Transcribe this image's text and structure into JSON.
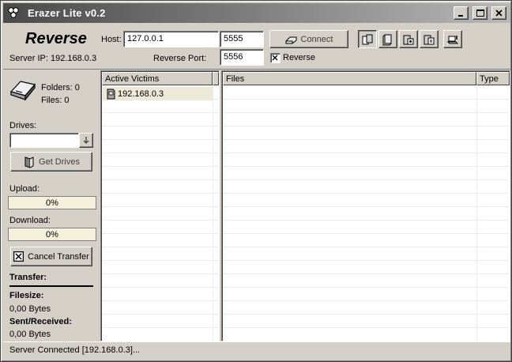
{
  "window": {
    "title": "Erazer Lite v0.2",
    "app_icon": "erazer-app-icon",
    "controls": [
      "minimize-icon",
      "maximize-icon",
      "close-icon"
    ]
  },
  "connection": {
    "mode_title": "Reverse",
    "server_ip_label": "Server IP: 192.168.0.3",
    "host_label": "Host:",
    "host_value": "127.0.0.1",
    "port_value": "5555",
    "reverse_port_label": "Reverse Port:",
    "reverse_port_value": "5556",
    "connect_label": "Connect",
    "reverse_checkbox_label": "Reverse",
    "reverse_checked": true
  },
  "toolbar": {
    "icons": [
      "file-manager-icon",
      "drive-icon",
      "explorer-icon",
      "process-icon",
      "settings-icon"
    ],
    "active_index": 0
  },
  "sidebar": {
    "folders_label": "Folders: 0",
    "files_label": "Files: 0",
    "drives_label": "Drives:",
    "drives_selected": "",
    "get_drives_label": "Get Drives",
    "upload_label": "Upload:",
    "upload_percent": "0%",
    "upload_fraction": 0,
    "download_label": "Download:",
    "download_percent": "0%",
    "download_fraction": 0,
    "cancel_transfer_label": "Cancel Transfer",
    "transfer_heading": "Transfer:",
    "filesize_label": "Filesize:",
    "filesize_value": "0,00 Bytes",
    "sent_received_label": "Sent/Received:",
    "sent_received_value": "0,00 Bytes"
  },
  "victims": {
    "header": "Active Victims",
    "items": [
      {
        "label": "192.168.0.3",
        "icon": "computer-icon"
      }
    ]
  },
  "files": {
    "columns": [
      "Files",
      "Type"
    ],
    "rows": []
  },
  "status": {
    "text": "Server Connected [192.168.0.3]..."
  },
  "colors": {
    "face": "#d4d0c8",
    "title_start": "#4a4a4a",
    "title_end": "#b8b8b8",
    "selection": "#ece9d8",
    "progress_bg": "#f4f0dc"
  }
}
